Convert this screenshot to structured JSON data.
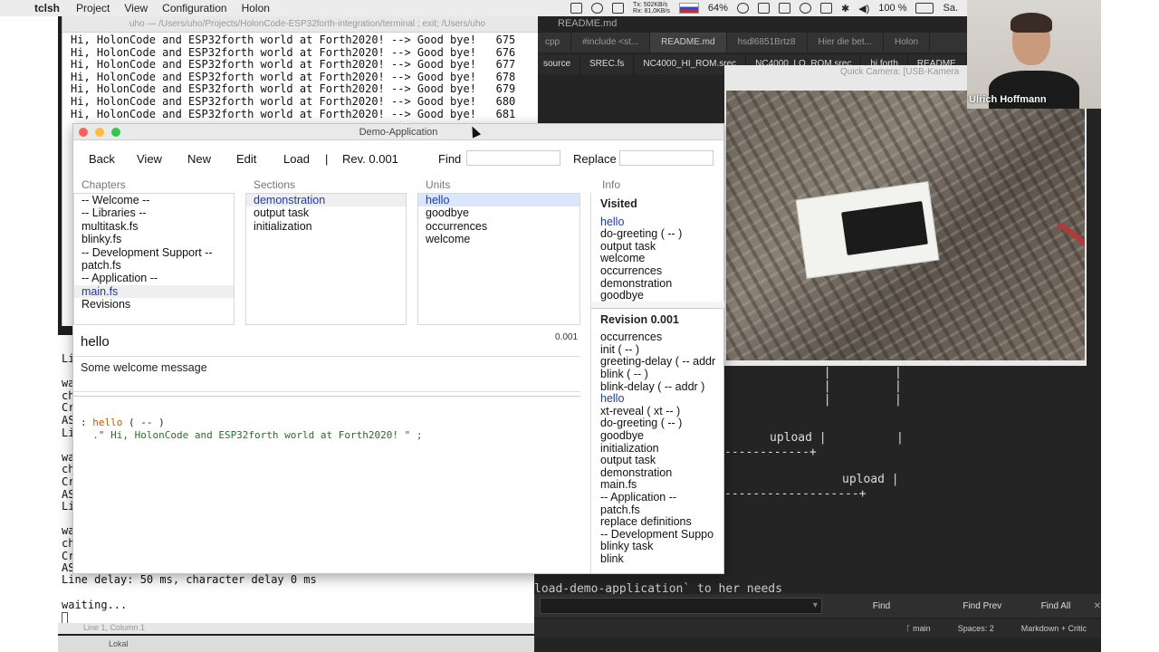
{
  "menubar": {
    "app_name": "tclsh",
    "items": [
      "Project",
      "View",
      "Configuration",
      "Holon"
    ],
    "net_tx": "Tx: 502KB/s",
    "net_rx": "Rx: 81,0KB/s",
    "battery_cpu": "64%",
    "battery": "100 %",
    "clock": "Sa."
  },
  "terminal_top": {
    "title": "uho — /Users/uho/Projects/HolonCode-ESP32forth-integration/terminal ; exit; /Users/uho",
    "lines": [
      "Hi, HolonCode and ESP32forth world at Forth2020! --> Good bye!   675",
      "Hi, HolonCode and ESP32forth world at Forth2020! --> Good bye!   676",
      "Hi, HolonCode and ESP32forth world at Forth2020! --> Good bye!   677",
      "Hi, HolonCode and ESP32forth world at Forth2020! --> Good bye!   678",
      "Hi, HolonCode and ESP32forth world at Forth2020! --> Good bye!   679",
      "Hi, HolonCode and ESP32forth world at Forth2020! --> Good bye!   680",
      "Hi, HolonCode and ESP32forth world at Forth2020! --> Good bye!   681"
    ]
  },
  "terminal_low": {
    "lines_a": [
      "Li",
      "",
      "wa",
      "ch",
      "Cr",
      "AS",
      "Li",
      "",
      "wa",
      "ch",
      "Cr",
      "AS",
      "Li",
      "",
      "wa",
      "ch",
      "Cr",
      "AS"
    ],
    "delay_line": "Line delay: 50 ms, character delay 0 ms",
    "waiting": "waiting...",
    "status": "Line 1, Column 1",
    "status2": "Lokal"
  },
  "editor": {
    "title": "README.md",
    "tabs_row1": [
      "cpp",
      "#include <st...",
      "README.md",
      "hsdl6851Brtz8",
      "Hier die bet...",
      "Holon"
    ],
    "tabs_row2": [
      "source",
      "SREC.fs",
      "NC4000_HI_ROM.srec",
      "NC4000_LO_ROM.srec",
      "hi.forth",
      "README"
    ],
    "ascii_upload1": "upload |",
    "ascii_upload2": "upload |",
    "cmdline": "load-demo-application` to her needs",
    "find_btn": "Find",
    "find_prev_btn": "Find Prev",
    "find_all_btn": "Find All",
    "branch": "main",
    "spaces": "Spaces: 2",
    "syntax": "Markdown + Critic"
  },
  "demo": {
    "title": "Demo-Application",
    "toolbar": {
      "back": "Back",
      "view": "View",
      "new": "New",
      "edit": "Edit",
      "load": "Load",
      "sep": "|",
      "rev": "Rev. 0.001",
      "find": "Find",
      "replace": "Replace"
    },
    "chapters_head": "Chapters",
    "sections_head": "Sections",
    "units_head": "Units",
    "info_head": "Info",
    "chapters": [
      "-- Welcome --",
      "-- Libraries --",
      "multitask.fs",
      "blinky.fs",
      "-- Development Support --",
      "patch.fs",
      "-- Application --",
      "main.fs",
      "Revisions"
    ],
    "sections": [
      "demonstration",
      "output task",
      "initialization"
    ],
    "units": [
      "hello",
      "goodbye",
      "occurrences",
      "welcome"
    ],
    "visited_head": "Visited",
    "visited": [
      "hello",
      "do-greeting ( -- )",
      "output task",
      "welcome",
      "occurrences",
      "demonstration",
      "goodbye"
    ],
    "revision_head": "Revision 0.001",
    "revision_items": [
      "occurrences",
      "init ( -- )",
      "greeting-delay ( -- addr",
      "blink ( -- )",
      "blink-delay ( -- addr )",
      "hello",
      "xt-reveal ( xt -- )",
      "do-greeting ( -- )",
      "goodbye",
      "initialization",
      "output task",
      "demonstration",
      "main.fs",
      "-- Application --",
      "patch.fs",
      "replace definitions",
      "-- Development Suppo",
      "blinky task",
      "blink"
    ],
    "unit_name": "hello",
    "unit_rev": "0.001",
    "unit_comment": "Some welcome message",
    "code_prefix": ": ",
    "code_word": "hello",
    "code_stack": " ( -- )",
    "code_line2": "  .\" Hi, HolonCode and ESP32forth world at Forth2020! \" ;"
  },
  "camera": {
    "title": "Quick Camera: [USB-Kamera"
  },
  "video": {
    "person_name": "Ulrich Hoffmann"
  },
  "colors": {
    "selection_bg": "#d9e6fb",
    "link_blue": "#1d3aa8",
    "editor_bg": "#242424"
  }
}
